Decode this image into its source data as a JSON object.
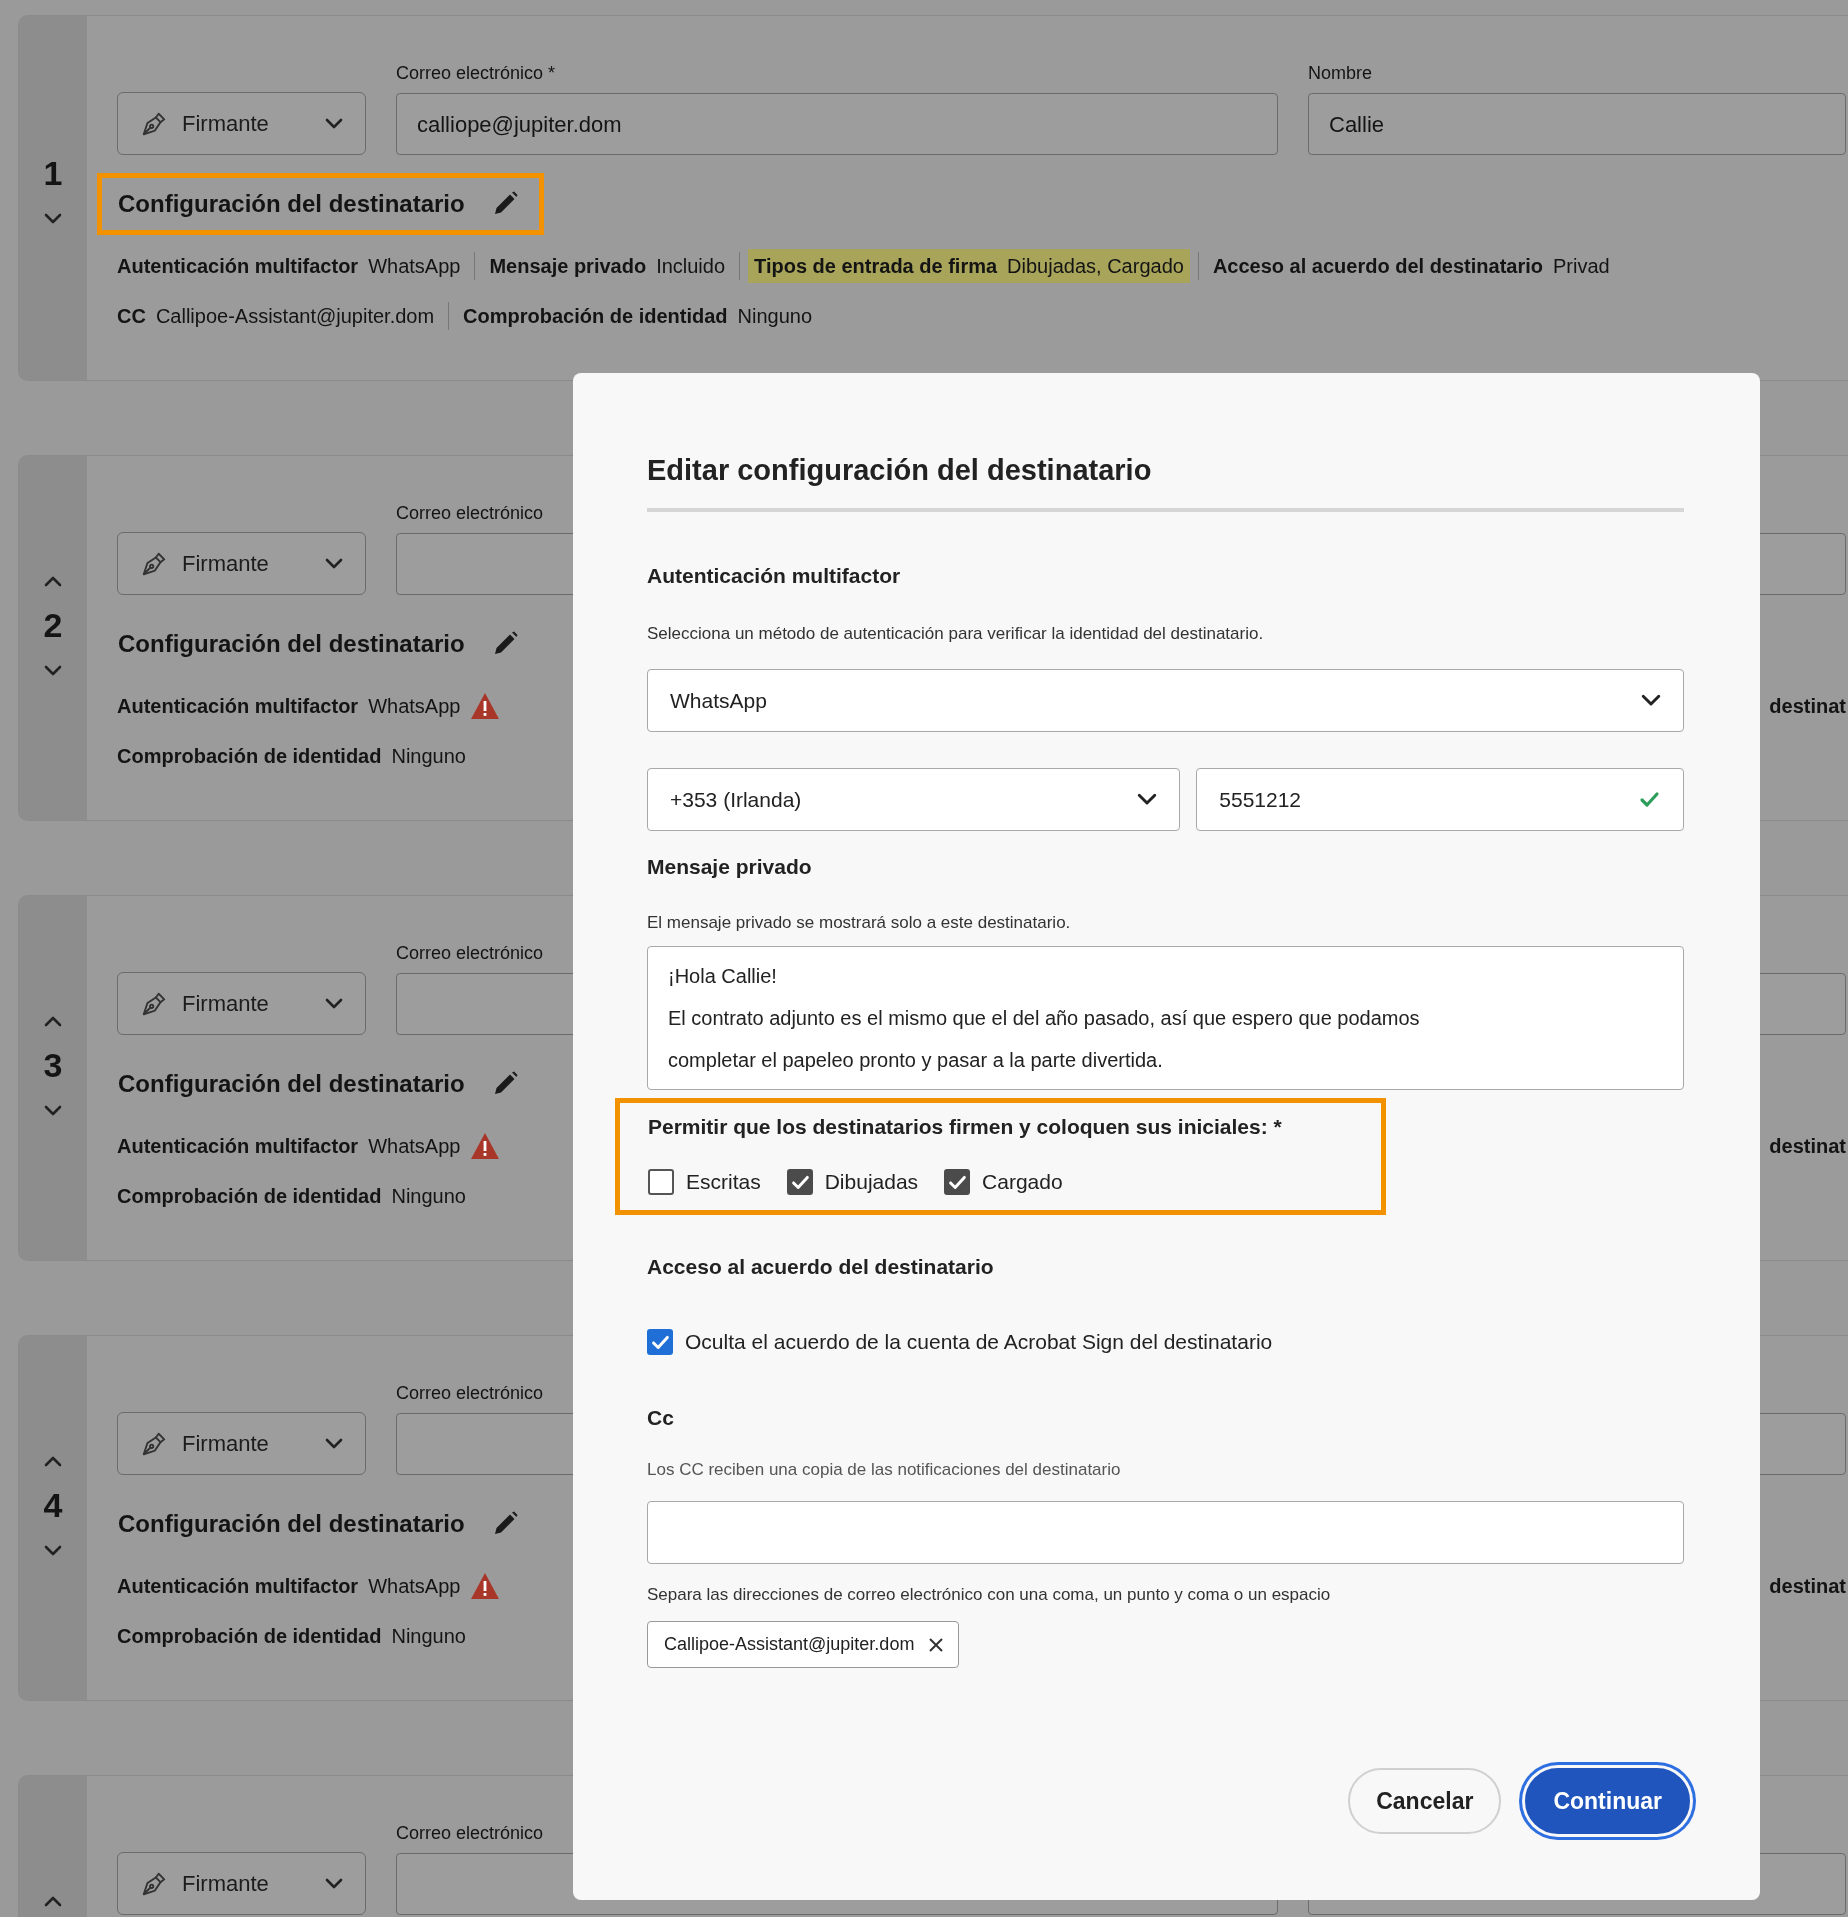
{
  "cards": [
    {
      "number": "1",
      "move_up": false,
      "move_down": true,
      "role": "Firmante",
      "email_label": "Correo electrónico *",
      "email": "calliope@jupiter.dom",
      "name_label": "Nombre",
      "name": "Callie",
      "title": "Configuración del destinatario",
      "title_highlighted": true,
      "meta_rows": [
        [
          {
            "label": "Autenticación multifactor",
            "value": "WhatsApp",
            "marked": false,
            "warning": false
          },
          {
            "label": "Mensaje privado",
            "value": "Incluido",
            "marked": false,
            "warning": false
          },
          {
            "label": "Tipos de entrada de firma",
            "value": "Dibujadas, Cargado",
            "marked": true,
            "warning": false
          },
          {
            "label": "Acceso al acuerdo del destinatario",
            "value": "Privad",
            "marked": false,
            "warning": false
          }
        ],
        [
          {
            "label": "CC",
            "value": "Callipoe-Assistant@jupiter.dom",
            "marked": false,
            "warning": false
          },
          {
            "label": "Comprobación de identidad",
            "value": "Ninguno",
            "marked": false,
            "warning": false
          }
        ]
      ]
    },
    {
      "number": "2",
      "move_up": true,
      "move_down": true,
      "role": "Firmante",
      "email_label": "Correo electrónico",
      "title": "Configuración del destinatario",
      "title_highlighted": false,
      "meta_rows": [
        [
          {
            "label": "Autenticación multifactor",
            "value": "WhatsApp",
            "marked": false,
            "warning": true
          }
        ],
        [
          {
            "label": "Comprobación de identidad",
            "value": "Ninguno",
            "marked": false,
            "warning": false
          }
        ]
      ],
      "right_fragment": "destinat"
    },
    {
      "number": "3",
      "move_up": true,
      "move_down": true,
      "role": "Firmante",
      "email_label": "Correo electrónico",
      "title": "Configuración del destinatario",
      "title_highlighted": false,
      "meta_rows": [
        [
          {
            "label": "Autenticación multifactor",
            "value": "WhatsApp",
            "marked": false,
            "warning": true
          }
        ],
        [
          {
            "label": "Comprobación de identidad",
            "value": "Ninguno",
            "marked": false,
            "warning": false
          }
        ]
      ],
      "right_fragment": "destinat"
    },
    {
      "number": "4",
      "move_up": true,
      "move_down": true,
      "role": "Firmante",
      "email_label": "Correo electrónico",
      "title": "Configuración del destinatario",
      "title_highlighted": false,
      "meta_rows": [
        [
          {
            "label": "Autenticación multifactor",
            "value": "WhatsApp",
            "marked": false,
            "warning": true
          }
        ],
        [
          {
            "label": "Comprobación de identidad",
            "value": "Ninguno",
            "marked": false,
            "warning": false
          }
        ]
      ],
      "right_fragment": "destinat"
    },
    {
      "move_up": true,
      "move_down": false,
      "role": "Firmante",
      "email_label": "Correo electrónico"
    }
  ],
  "dialog": {
    "title": "Editar configuración del destinatario",
    "mfa": {
      "heading": "Autenticación multifactor",
      "description": "Selecciona un método de autenticación para verificar la identidad del destinatario.",
      "method": "WhatsApp",
      "country_code": "+353 (Irlanda)",
      "phone": "5551212",
      "phone_valid": true
    },
    "private_message": {
      "heading": "Mensaje privado",
      "description": "El mensaje privado se mostrará solo a este destinatario.",
      "lines": [
        "¡Hola Callie!",
        "El contrato adjunto es el mismo que el del año pasado, así que espero que podamos",
        "completar el papeleo pronto y pasar a la parte divertida."
      ]
    },
    "signature_types": {
      "heading": "Permitir que los destinatarios firmen y coloquen sus iniciales: *",
      "highlighted": true,
      "options": [
        {
          "label": "Escritas",
          "checked": false
        },
        {
          "label": "Dibujadas",
          "checked": true
        },
        {
          "label": "Cargado",
          "checked": true
        }
      ]
    },
    "access": {
      "heading": "Acceso al acuerdo del destinatario",
      "option": {
        "label": "Oculta el acuerdo de la cuenta de Acrobat Sign del destinatario",
        "checked": true
      }
    },
    "cc": {
      "heading": "Cc",
      "description": "Los CC reciben una copia de las notificaciones del destinatario",
      "hint": "Separa las direcciones de correo electrónico con una coma, un punto y coma o un espacio",
      "tags": [
        "Callipoe-Assistant@jupiter.dom"
      ]
    },
    "buttons": [
      {
        "label": "Cancelar",
        "kind": "secondary",
        "focused": false
      },
      {
        "label": "Continuar",
        "kind": "primary",
        "focused": true
      }
    ]
  }
}
